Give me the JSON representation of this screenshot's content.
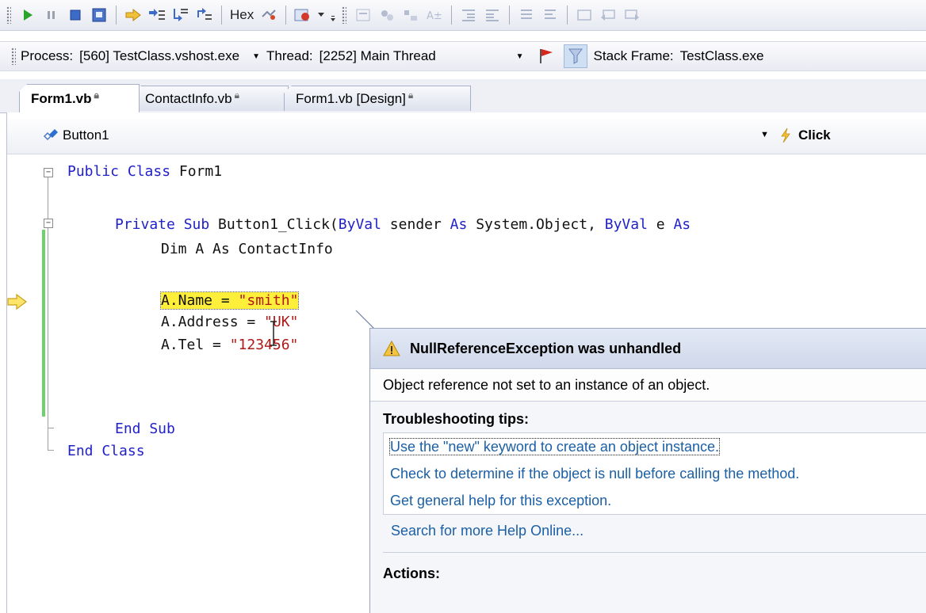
{
  "toolbar": {
    "hex_label": "Hex"
  },
  "debug_location": {
    "process_label": "Process:",
    "process_value": "[560] TestClass.vshost.exe",
    "thread_label": "Thread:",
    "thread_value": "[2252] Main Thread",
    "stack_frame_label": "Stack Frame:",
    "stack_frame_value": "TestClass.exe"
  },
  "tabs": [
    {
      "label": "Form1.vb",
      "active": true
    },
    {
      "label": "ContactInfo.vb",
      "active": false
    },
    {
      "label": "Form1.vb [Design]",
      "active": false
    }
  ],
  "navbar": {
    "object_value": "Button1",
    "event_value": "Click"
  },
  "code": {
    "l1_kw": "Public Class",
    "l1_rest": " Form1",
    "l2_kw1": "Private Sub",
    "l2_mid": " Button1_Click(",
    "l2_kw2": "ByVal",
    "l2_mid2": " sender ",
    "l2_kw3": "As",
    "l2_mid3": " System.Object, ",
    "l2_kw4": "ByVal",
    "l2_mid4": " e ",
    "l2_kw5": "As",
    "l3": "Dim A As ContactInfo",
    "l4_pre": "A.Name = ",
    "l4_str": "\"smith\"",
    "l5_pre": "A.Address = ",
    "l5_str": "\"UK\"",
    "l6_pre": "A.Tel = ",
    "l6_str": "\"123456\"",
    "l7": "End Sub",
    "l8": "End Class"
  },
  "exception": {
    "title": "NullReferenceException was unhandled",
    "message": "Object reference not set to an instance of an object.",
    "tips_heading": "Troubleshooting tips:",
    "tips": [
      "Use the \"new\" keyword to create an object instance.",
      "Check to determine if the object is null before calling the method.",
      "Get general help for this exception."
    ],
    "search_link": "Search for more Help Online...",
    "actions_heading": "Actions:"
  },
  "colors": {
    "keyword": "#2121c8",
    "string": "#b01818",
    "highlight": "#ffef3a",
    "link": "#1b5fa5"
  }
}
